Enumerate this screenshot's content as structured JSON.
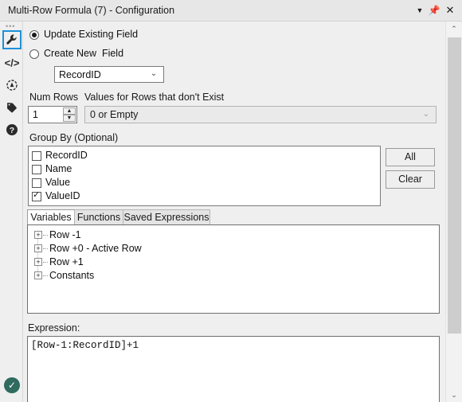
{
  "window": {
    "title": "Multi-Row Formula (7) - Configuration",
    "controls": [
      {
        "name": "caret-down-icon",
        "glyph": "▼"
      },
      {
        "name": "pin-icon",
        "glyph": "📌"
      },
      {
        "name": "close-icon",
        "glyph": "✕"
      }
    ]
  },
  "rail": {
    "dots": "•••",
    "icons": [
      {
        "name": "wrench-icon",
        "selected": true
      },
      {
        "name": "code-icon",
        "selected": false
      },
      {
        "name": "target-icon",
        "selected": false
      },
      {
        "name": "tag-icon",
        "selected": false
      },
      {
        "name": "help-icon",
        "selected": false
      }
    ],
    "status_check": "✓"
  },
  "main": {
    "radios": [
      {
        "label": "Update Existing Field",
        "selected": true
      },
      {
        "label": "Create New  Field",
        "selected": false
      }
    ],
    "field_select": {
      "value": "RecordID",
      "caret": "⌄"
    },
    "num_rows": {
      "label": "Num Rows",
      "value": "1",
      "up": "▲",
      "down": "▼"
    },
    "values_select": {
      "label": "Values for Rows that don't Exist",
      "value": "0 or Empty",
      "caret": "⌄"
    },
    "group_by": {
      "label": "Group By (Optional)",
      "items": [
        {
          "label": "RecordID",
          "checked": false
        },
        {
          "label": "Name",
          "checked": false
        },
        {
          "label": "Value",
          "checked": false
        },
        {
          "label": "ValueID",
          "checked": true
        }
      ],
      "all_button": "All",
      "clear_button": "Clear"
    },
    "tabs": [
      {
        "label": "Variables",
        "active": true
      },
      {
        "label": "Functions",
        "active": false
      },
      {
        "label": "Saved Expressions",
        "active": false
      }
    ],
    "tree": [
      {
        "label": "Row -1",
        "expander": "+"
      },
      {
        "label": "Row +0 - Active Row",
        "expander": "+"
      },
      {
        "label": "Row +1",
        "expander": "+"
      },
      {
        "label": "Constants",
        "expander": "+"
      }
    ],
    "expression": {
      "label": "Expression:",
      "value": "[Row-1:RecordID]+1"
    }
  },
  "scrollbar": {
    "up": "⌃",
    "down": "⌄"
  },
  "colors": {
    "accent": "#1e90d8",
    "status_green": "#2f6b5f",
    "window_bg": "#efefef",
    "titlebar_bg": "#e7e7e7"
  }
}
